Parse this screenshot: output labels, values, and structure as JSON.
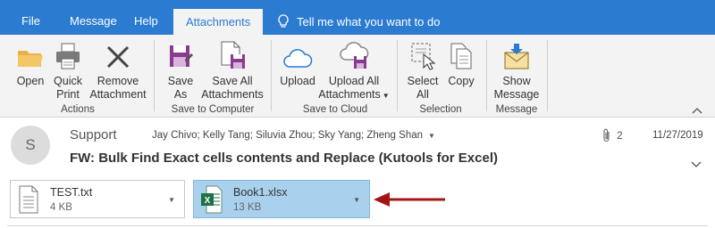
{
  "tabs": [
    {
      "label": "File"
    },
    {
      "label": "Message"
    },
    {
      "label": "Help"
    },
    {
      "label": "Attachments",
      "active": true
    }
  ],
  "tell_me": "Tell me what you want to do",
  "ribbon": {
    "open": "Open",
    "quick_print_1": "Quick",
    "quick_print_2": "Print",
    "remove_1": "Remove",
    "remove_2": "Attachment",
    "group_actions": "Actions",
    "save_as_1": "Save",
    "save_as_2": "As",
    "save_all_1": "Save All",
    "save_all_2": "Attachments",
    "group_save_computer": "Save to Computer",
    "upload": "Upload",
    "upload_all_1": "Upload All",
    "upload_all_2": "Attachments",
    "group_save_cloud": "Save to Cloud",
    "select_all_1": "Select",
    "select_all_2": "All",
    "copy": "Copy",
    "group_selection": "Selection",
    "show_message_1": "Show",
    "show_message_2": "Message",
    "group_message": "Message"
  },
  "message": {
    "avatar_initial": "S",
    "sender": "Support",
    "recipients": "Jay Chivo; Kelly Tang; Siluvia Zhou; Sky Yang; Zheng Shan",
    "attachment_count": "2",
    "date": "11/27/2019",
    "subject": "FW: Bulk Find Exact cells contents and Replace (Kutools for Excel)"
  },
  "attachments": [
    {
      "name": "TEST.txt",
      "size": "4 KB",
      "icon": "text-file-icon",
      "selected": false
    },
    {
      "name": "Book1.xlsx",
      "size": "13 KB",
      "icon": "excel-file-icon",
      "selected": true
    }
  ],
  "colors": {
    "tab_bar": "#2b7bd1",
    "ribbon_bg": "#f3f3f3",
    "selected_attachment": "#a9d1ee",
    "annotation_arrow": "#a31515",
    "excel_green": "#1e7145"
  }
}
